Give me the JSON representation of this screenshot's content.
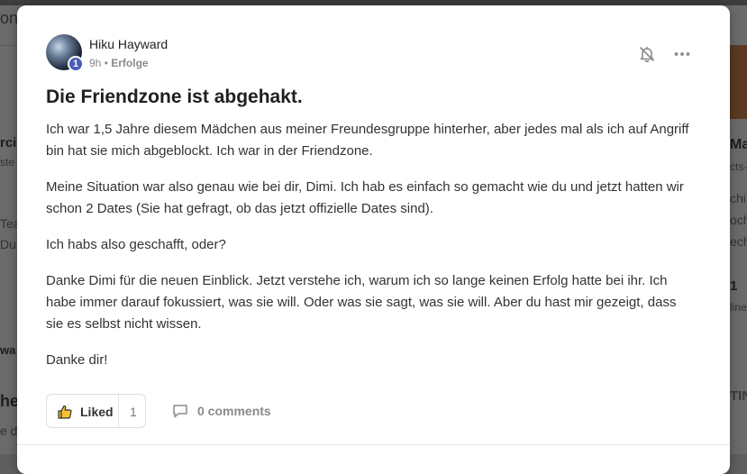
{
  "post": {
    "author": "Hiku Hayward",
    "level": "1",
    "time": "9h",
    "separator": "•",
    "category": "Erfolge",
    "title": "Die Friendzone ist abgehakt.",
    "paragraphs": [
      "Ich war 1,5 Jahre diesem Mädchen aus meiner Freundesgruppe hinterher, aber jedes mal als ich auf Angriff bin hat sie mich abgeblockt. Ich war in der Friendzone.",
      "Meine Situation war also genau wie bei dir, Dimi. Ich hab es einfach so gemacht wie du und jetzt hatten wir schon 2 Dates (Sie hat gefragt, ob das jetzt offizielle Dates sind).",
      "Ich habs also geschafft, oder?",
      "Danke Dimi für die neuen Einblick. Jetzt verstehe ich, warum ich so lange keinen Erfolg hatte bei ihr. Ich habe immer darauf fokussiert, was sie will. Oder was sie sagt, was sie will. Aber du hast mir gezeigt, dass sie es selbst nicht wissen.",
      "Danke dir!"
    ],
    "like_label": "Liked",
    "like_count": "1",
    "comments_label": "0 comments"
  },
  "icons": {
    "bell": "bell-off-icon",
    "more": "more-horizontal-icon",
    "thumb": "thumbs-up-icon",
    "comment": "comment-icon"
  },
  "colors": {
    "level_badge": "#4a5bb8",
    "muted": "#8a8a8a",
    "overlay": "#6b6b6b"
  },
  "background": {
    "left_fragments": [
      "on",
      "rcio",
      "ste",
      "Tea",
      "Du",
      "wa",
      "he",
      "e di"
    ],
    "right_fragments": [
      "Mas",
      "cts-",
      "chi",
      "och",
      "ech",
      "1",
      "line",
      "TIN"
    ]
  }
}
